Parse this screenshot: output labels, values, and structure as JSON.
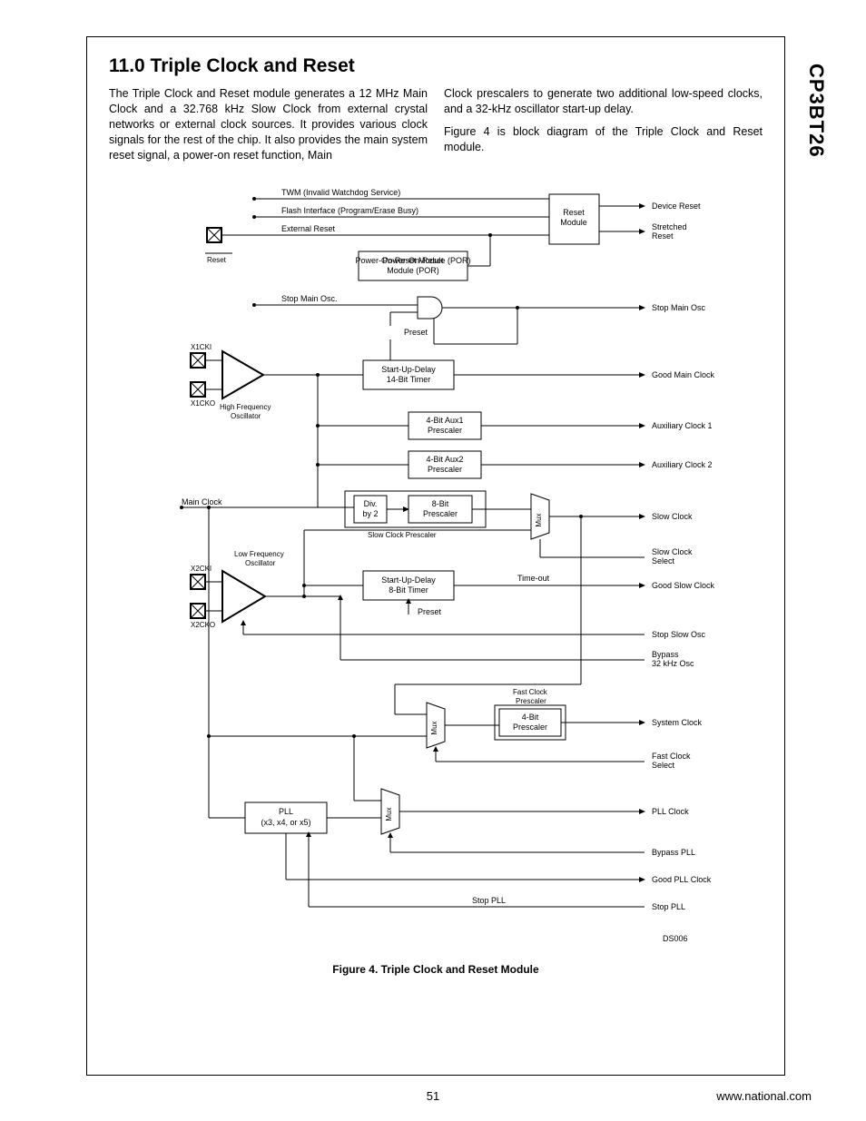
{
  "side_label": "CP3BT26",
  "section_title": "11.0  Triple Clock and Reset",
  "col_left": "The Triple Clock and Reset module generates a 12 MHz Main Clock and a 32.768 kHz Slow Clock from external crystal networks or external clock sources. It provides various clock signals for the rest of the chip. It also provides the main system reset signal, a power-on reset function, Main",
  "col_right_p1": "Clock prescalers to generate two additional low-speed clocks, and a 32-kHz oscillator start-up delay.",
  "col_right_p2": "Figure 4 is block diagram of the Triple Clock and Reset module.",
  "figure_caption": "Figure 4.   Triple Clock and Reset Module",
  "page_number": "51",
  "footer_url": "www.national.com",
  "diagram": {
    "inputs": {
      "twm": "TWM (Invalid Watchdog Service)",
      "flash": "Flash Interface (Program/Erase Busy)",
      "ext_reset": "External Reset",
      "reset_pin": "Reset",
      "x1cki": "X1CKI",
      "x1cko": "X1CKO",
      "x2cki": "X2CKI",
      "x2cko": "X2CKO",
      "hf_osc": "High Frequency\nOscillator",
      "lf_osc": "Low Frequency\nOscillator",
      "main_clock": "Main Clock",
      "stop_main_osc_in": "Stop Main Osc.",
      "preset1": "Preset",
      "preset2": "Preset",
      "time_out": "Time-out",
      "slow_clock_prescaler_lbl": "Slow Clock Prescaler",
      "stop_pll_lbl": "Stop PLL"
    },
    "blocks": {
      "reset_module": "Reset\nModule",
      "por": "Power-On-Reset\nModule (POR)",
      "sud14": "Start-Up-Delay\n14-Bit Timer",
      "aux1": "4-Bit Aux1\nPrescaler",
      "aux2": "4-Bit Aux2\nPrescaler",
      "div2": "Div.\nby 2",
      "presc8": "8-Bit\nPrescaler",
      "sud8": "Start-Up-Delay\n8-Bit Timer",
      "fast_presc_lbl": "Fast Clock\nPrescaler",
      "presc4": "4-Bit\nPrescaler",
      "pll": "PLL\n(x3, x4, or x5)",
      "mux": "Mux"
    },
    "outputs": {
      "device_reset": "Device Reset",
      "stretched_reset": "Stretched\nReset",
      "stop_main_osc": "Stop Main Osc",
      "good_main_clock": "Good Main Clock",
      "aux_clock_1": "Auxiliary Clock 1",
      "aux_clock_2": "Auxiliary Clock 2",
      "slow_clock": "Slow Clock",
      "slow_clock_select": "Slow Clock\nSelect",
      "good_slow_clock": "Good Slow Clock",
      "stop_slow_osc": "Stop Slow Osc",
      "bypass_32k": "Bypass\n32 kHz Osc",
      "system_clock": "System Clock",
      "fast_clock_select": "Fast Clock\nSelect",
      "pll_clock": "PLL Clock",
      "bypass_pll": "Bypass PLL",
      "good_pll_clock": "Good PLL Clock",
      "stop_pll": "Stop PLL"
    },
    "ds_code": "DS006",
    "chart_data": {
      "type": "block-diagram",
      "nodes": [
        {
          "id": "reset_pin",
          "kind": "pad",
          "label": "Reset"
        },
        {
          "id": "x1cki",
          "kind": "pad",
          "label": "X1CKI"
        },
        {
          "id": "x1cko",
          "kind": "pad",
          "label": "X1CKO"
        },
        {
          "id": "x2cki",
          "kind": "pad",
          "label": "X2CKI"
        },
        {
          "id": "x2cko",
          "kind": "pad",
          "label": "X2CKO"
        },
        {
          "id": "hf_osc",
          "kind": "amp",
          "label": "High Frequency Oscillator"
        },
        {
          "id": "lf_osc",
          "kind": "amp",
          "label": "Low Frequency Oscillator"
        },
        {
          "id": "por",
          "kind": "block",
          "label": "Power-On-Reset Module (POR)"
        },
        {
          "id": "reset_module",
          "kind": "block",
          "label": "Reset Module"
        },
        {
          "id": "and_gate",
          "kind": "and",
          "label": ""
        },
        {
          "id": "sud14",
          "kind": "block",
          "label": "Start-Up-Delay 14-Bit Timer"
        },
        {
          "id": "aux1",
          "kind": "block",
          "label": "4-Bit Aux1 Prescaler"
        },
        {
          "id": "aux2",
          "kind": "block",
          "label": "4-Bit Aux2 Prescaler"
        },
        {
          "id": "div2",
          "kind": "block",
          "label": "Div. by 2"
        },
        {
          "id": "presc8",
          "kind": "block",
          "label": "8-Bit Prescaler"
        },
        {
          "id": "mux_slow",
          "kind": "mux",
          "label": "Mux"
        },
        {
          "id": "sud8",
          "kind": "block",
          "label": "Start-Up-Delay 8-Bit Timer"
        },
        {
          "id": "mux_fast",
          "kind": "mux",
          "label": "Mux"
        },
        {
          "id": "presc4",
          "kind": "block",
          "label": "4-Bit Prescaler"
        },
        {
          "id": "mux_pll",
          "kind": "mux",
          "label": "Mux"
        },
        {
          "id": "pll",
          "kind": "block",
          "label": "PLL (x3, x4, or x5)"
        }
      ],
      "edges": [
        {
          "from": "twm",
          "to": "reset_module",
          "label": "TWM (Invalid Watchdog Service)"
        },
        {
          "from": "flash",
          "to": "reset_module",
          "label": "Flash Interface (Program/Erase Busy)"
        },
        {
          "from": "ext_reset",
          "to": "reset_module",
          "label": "External Reset"
        },
        {
          "from": "reset_pin",
          "to": "reset_module"
        },
        {
          "from": "por",
          "to": "reset_module"
        },
        {
          "from": "reset_module",
          "to": "device_reset",
          "label": "Device Reset"
        },
        {
          "from": "reset_module",
          "to": "stretched_reset",
          "label": "Stretched Reset"
        },
        {
          "from": "stop_main_osc_sig",
          "to": "and_gate",
          "label": "Stop Main Osc."
        },
        {
          "from": "and_gate",
          "to": "stop_main_osc",
          "label": "Stop Main Osc"
        },
        {
          "from": "x1cki",
          "to": "hf_osc"
        },
        {
          "from": "x1cko",
          "to": "hf_osc"
        },
        {
          "from": "hf_osc",
          "to": "sud14"
        },
        {
          "from": "sud14",
          "to": "good_main_clock",
          "label": "Good Main Clock"
        },
        {
          "from": "preset",
          "to": "sud14",
          "label": "Preset"
        },
        {
          "from": "hf_osc",
          "to": "aux1"
        },
        {
          "from": "aux1",
          "to": "aux_clock_1",
          "label": "Auxiliary Clock 1"
        },
        {
          "from": "hf_osc",
          "to": "aux2"
        },
        {
          "from": "aux2",
          "to": "aux_clock_2",
          "label": "Auxiliary Clock 2"
        },
        {
          "from": "hf_osc",
          "to": "div2",
          "label": "Main Clock"
        },
        {
          "from": "div2",
          "to": "presc8"
        },
        {
          "from": "presc8",
          "to": "mux_slow"
        },
        {
          "from": "lf_osc",
          "to": "mux_slow"
        },
        {
          "from": "mux_slow",
          "to": "slow_clock",
          "label": "Slow Clock"
        },
        {
          "from": "slow_clock_select",
          "to": "mux_slow",
          "label": "Slow Clock Select"
        },
        {
          "from": "x2cki",
          "to": "lf_osc"
        },
        {
          "from": "x2cko",
          "to": "lf_osc"
        },
        {
          "from": "lf_osc",
          "to": "sud8"
        },
        {
          "from": "sud8",
          "to": "good_slow_clock",
          "label": "Good Slow Clock / Time-out"
        },
        {
          "from": "preset",
          "to": "sud8",
          "label": "Preset"
        },
        {
          "from": "stop_slow_osc",
          "to": "lf_osc",
          "label": "Stop Slow Osc"
        },
        {
          "from": "bypass_32k",
          "to": "sud8",
          "label": "Bypass 32 kHz Osc"
        },
        {
          "from": "mux_slow",
          "to": "mux_fast"
        },
        {
          "from": "hf_osc",
          "to": "mux_fast"
        },
        {
          "from": "mux_fast",
          "to": "presc4",
          "label": "Fast Clock Prescaler"
        },
        {
          "from": "presc4",
          "to": "system_clock",
          "label": "System Clock"
        },
        {
          "from": "fast_clock_select",
          "to": "mux_fast",
          "label": "Fast Clock Select"
        },
        {
          "from": "hf_osc",
          "to": "pll"
        },
        {
          "from": "pll",
          "to": "mux_pll"
        },
        {
          "from": "hf_osc",
          "to": "mux_pll"
        },
        {
          "from": "mux_pll",
          "to": "pll_clock",
          "label": "PLL Clock"
        },
        {
          "from": "bypass_pll",
          "to": "mux_pll",
          "label": "Bypass PLL"
        },
        {
          "from": "pll",
          "to": "good_pll_clock",
          "label": "Good PLL Clock"
        },
        {
          "from": "stop_pll",
          "to": "pll",
          "label": "Stop PLL"
        }
      ]
    }
  }
}
